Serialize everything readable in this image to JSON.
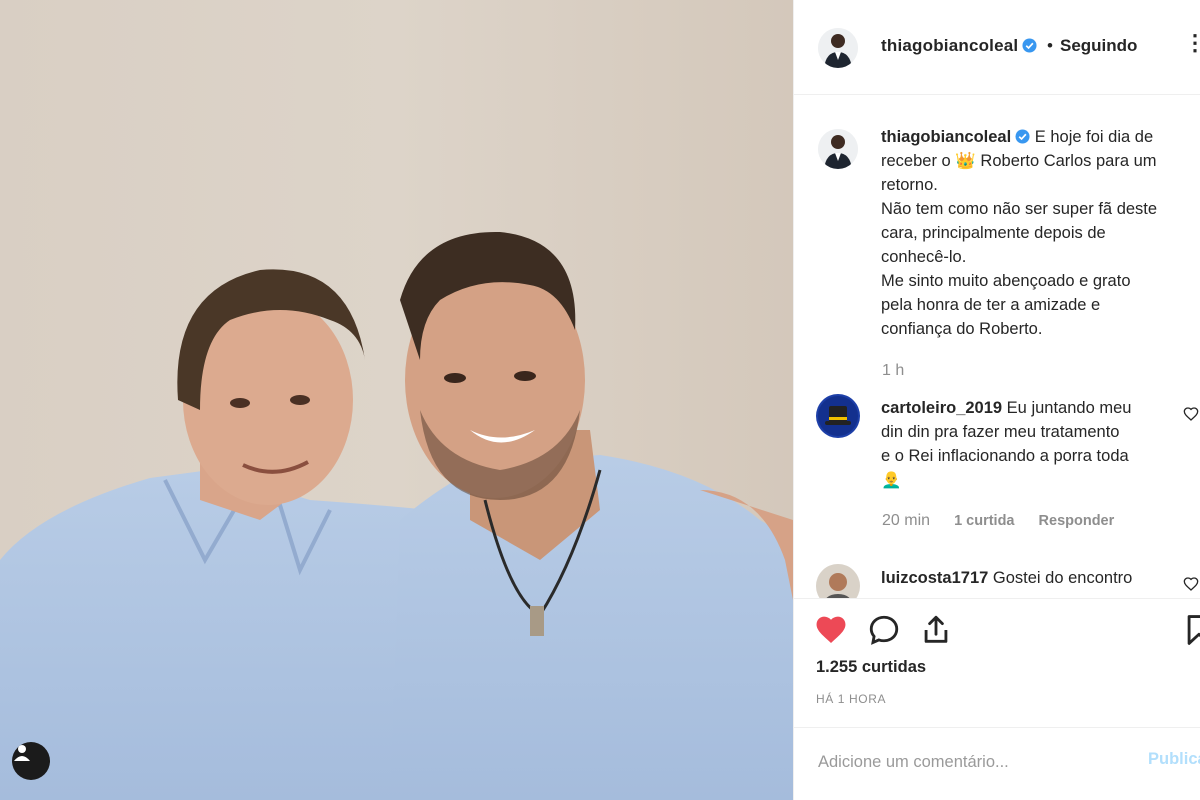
{
  "post": {
    "author": "thiagobiancoleal",
    "follow_status": "Seguindo",
    "follow_dot": "•",
    "more_icon": "more-options-icon",
    "caption_lines": [
      "E hoje foi dia de",
      "receber o 👑 Roberto Carlos para um",
      "retorno.",
      "Não tem como não ser super fã deste",
      "cara, principalmente depois de",
      "conhecê-lo.",
      "Me sinto muito abençoado e grato",
      "pela honra de ter a amizade e",
      "confiança do Roberto."
    ],
    "caption_time": "1 h"
  },
  "comments": [
    {
      "username": "cartoleiro_2019",
      "text": "Eu juntando meu",
      "lines": [
        "din din pra fazer meu tratamento",
        "e o Rei inflacionando a porra toda",
        "👨‍🦲"
      ],
      "time": "20 min",
      "likes": "1 curtida",
      "reply": "Responder"
    },
    {
      "username": "luizcosta1717",
      "text": "Gostei do encontro"
    }
  ],
  "actions": {
    "likes_count": "1.255 curtidas",
    "time_ago": "HÁ 1 HORA",
    "comment_placeholder": "Adicione um comentário...",
    "publish_label": "Publicar"
  },
  "colors": {
    "like_red": "#ed4956",
    "verified_blue": "#3897f0",
    "publish_blue": "#b2dffc",
    "muted_gray": "#8e8e8e"
  }
}
